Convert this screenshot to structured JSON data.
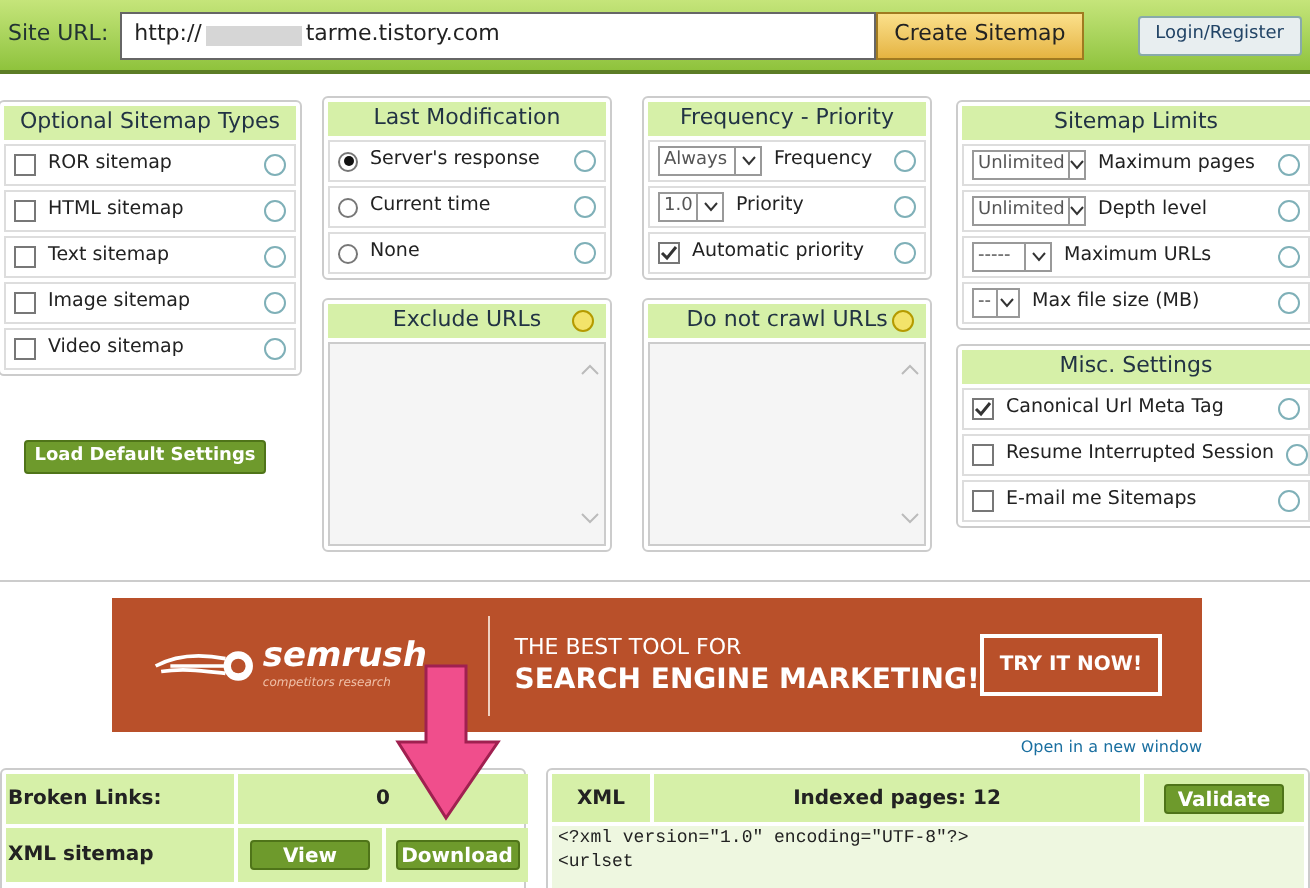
{
  "header": {
    "label": "Site URL:",
    "url_prefix": "http://",
    "url_suffix": "tarme.tistory.com",
    "create_button": "Create Sitemap",
    "login_button": "Login/Register"
  },
  "sitemap_types": {
    "title": "Optional Sitemap Types",
    "items": [
      {
        "label": "ROR sitemap",
        "checked": false
      },
      {
        "label": "HTML sitemap",
        "checked": false
      },
      {
        "label": "Text sitemap",
        "checked": false
      },
      {
        "label": "Image sitemap",
        "checked": false
      },
      {
        "label": "Video sitemap",
        "checked": false
      }
    ]
  },
  "load_defaults_button": "Load Default Settings",
  "last_modification": {
    "title": "Last Modification",
    "options": [
      {
        "label": "Server's response",
        "selected": true
      },
      {
        "label": "Current time",
        "selected": false
      },
      {
        "label": "None",
        "selected": false
      }
    ]
  },
  "exclude_urls": {
    "title": "Exclude URLs"
  },
  "frequency_priority": {
    "title": "Frequency - Priority",
    "rows": [
      {
        "kind": "select",
        "value": "Always",
        "label": "Frequency"
      },
      {
        "kind": "select",
        "value": "1.0",
        "label": "Priority"
      },
      {
        "kind": "checkbox",
        "checked": true,
        "label": "Automatic priority"
      }
    ]
  },
  "do_not_crawl_urls": {
    "title": "Do not crawl URLs"
  },
  "sitemap_limits": {
    "title": "Sitemap Limits",
    "rows": [
      {
        "value": "Unlimited",
        "label": "Maximum pages"
      },
      {
        "value": "Unlimited",
        "label": "Depth level"
      },
      {
        "value": "-----",
        "label": "Maximum URLs"
      },
      {
        "value": "--",
        "label": "Max file size (MB)"
      }
    ]
  },
  "misc_settings": {
    "title": "Misc. Settings",
    "items": [
      {
        "label": "Canonical Url Meta Tag",
        "checked": true
      },
      {
        "label": "Resume Interrupted Session",
        "checked": false
      },
      {
        "label": "E-mail me Sitemaps",
        "checked": false
      }
    ]
  },
  "ad": {
    "logo_text": "semrush",
    "logo_subtitle": "competitors research",
    "tagline_1": "THE BEST TOOL FOR",
    "tagline_2": "SEARCH ENGINE MARKETING!",
    "cta": "TRY IT NOW!"
  },
  "open_new_window": "Open in a new window",
  "results": {
    "broken_label": "Broken Links:",
    "broken_count": "0",
    "xml_label": "XML sitemap",
    "view_button": "View",
    "download_button": "Download"
  },
  "xml_panel": {
    "tab": "XML",
    "indexed": "Indexed pages: 12",
    "validate_button": "Validate",
    "lines": [
      "<?xml version=\"1.0\" encoding=\"UTF-8\"?>",
      "<urlset"
    ]
  }
}
